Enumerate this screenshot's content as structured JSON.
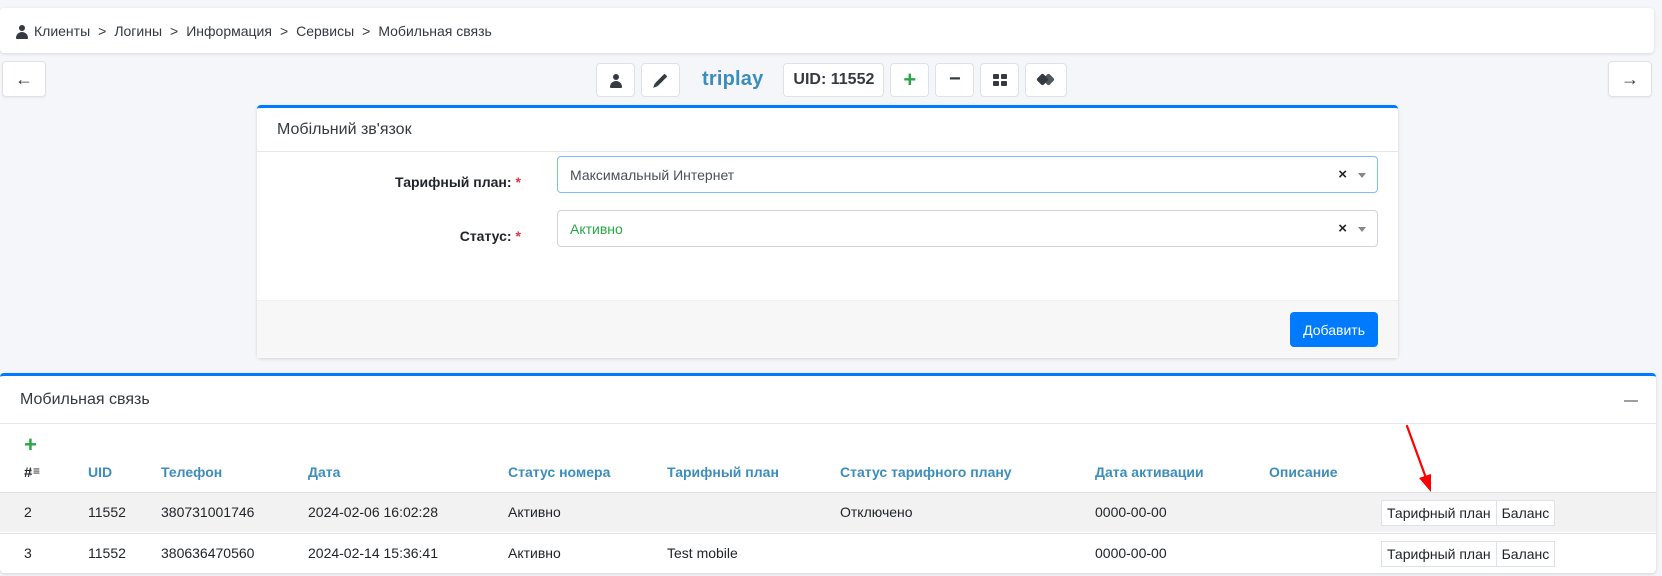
{
  "breadcrumb": {
    "items": [
      "Клиенты",
      "Логины",
      "Информация",
      "Сервисы",
      "Мобильная связь"
    ],
    "separator": ">"
  },
  "nav": {
    "back_icon": "arrow-left-icon",
    "forward_icon": "arrow-right-icon"
  },
  "toolbar": {
    "login_name": "triplay",
    "uid_label": "UID: 11552"
  },
  "form": {
    "title": "Мобільний зв'язок",
    "tariff_label": "Тарифный план:",
    "tariff_value": "Максимальный Интернет",
    "status_label": "Статус:",
    "status_value": "Активно",
    "required_mark": "*",
    "clear_glyph": "×",
    "submit_label": "Добавить",
    "status_value_color": "#28a745"
  },
  "list": {
    "title": "Мобильная связь",
    "columns": {
      "num": "#",
      "uid": "UID",
      "phone": "Телефон",
      "date": "Дата",
      "number_status": "Статус номера",
      "tariff": "Тарифный план",
      "tariff_status": "Статус тарифного плану",
      "activation_date": "Дата активации",
      "description": "Описание"
    },
    "rows": [
      {
        "num": "2",
        "uid": "11552",
        "phone": "380731001746",
        "date": "2024-02-06 16:02:28",
        "number_status": "Активно",
        "tariff": "",
        "tariff_status": "Отключено",
        "activation_date": "0000-00-00",
        "description": "",
        "action_tariff": "Тарифный план",
        "action_balance": "Баланс"
      },
      {
        "num": "3",
        "uid": "11552",
        "phone": "380636470560",
        "date": "2024-02-14 15:36:41",
        "number_status": "Активно",
        "tariff": "Test mobile",
        "tariff_status": "",
        "activation_date": "0000-00-00",
        "description": "",
        "action_tariff": "Тарифный план",
        "action_balance": "Баланс"
      }
    ]
  },
  "colors": {
    "accent": "#007bff",
    "link": "#3c8dbc",
    "success": "#28a745",
    "danger": "#dc3545",
    "annotation_arrow": "#ff0000"
  }
}
